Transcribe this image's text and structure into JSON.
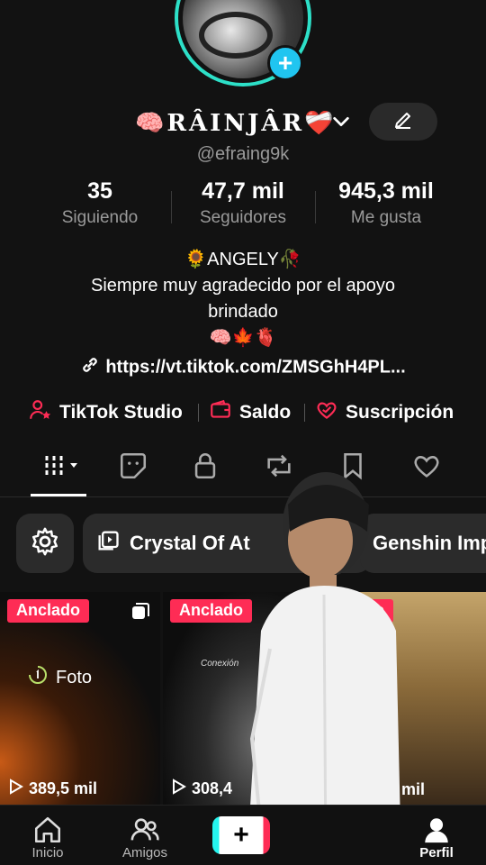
{
  "profile": {
    "display_name": "🧠RÂINJÂR❤️‍🩹",
    "handle": "@efraing9k",
    "add_icon": "plus-icon"
  },
  "stats": [
    {
      "value": "35",
      "label": "Siguiendo"
    },
    {
      "value": "47,7 mil",
      "label": "Seguidores"
    },
    {
      "value": "945,3 mil",
      "label": "Me gusta"
    }
  ],
  "bio": {
    "line1": "🌻ANGELY🥀",
    "line2": "Siempre muy agradecido por el apoyo",
    "line3": "brindado",
    "line4": "🧠🍁🫀"
  },
  "link": {
    "url": "https://vt.tiktok.com/ZMSGhH4PL..."
  },
  "quick_links": [
    {
      "label": "TikTok Studio",
      "icon": "person-star-icon"
    },
    {
      "label": "Saldo",
      "icon": "wallet-icon"
    },
    {
      "label": "Suscripción",
      "icon": "heart-check-icon"
    }
  ],
  "tabs": [
    "grid-icon",
    "sticker-icon",
    "lock-icon",
    "repost-icon",
    "bookmark-icon",
    "heart-icon"
  ],
  "playlists": [
    {
      "label": "Crystal Of At"
    },
    {
      "label": "Genshin Imp"
    }
  ],
  "videos": [
    {
      "badge": "Anclado",
      "views": "389,5 mil",
      "tag": "Foto"
    },
    {
      "badge": "Anclado",
      "views": "308,4",
      "caption": "Conexión"
    },
    {
      "badge": "clado",
      "views": "mil"
    }
  ],
  "nav": [
    {
      "label": "Inicio",
      "icon": "home-icon"
    },
    {
      "label": "Amigos",
      "icon": "friends-icon"
    },
    {
      "label": "+",
      "icon": "create-icon"
    },
    {
      "label": "Perfil",
      "icon": "profile-icon"
    }
  ],
  "colors": {
    "accent": "#fe2c55",
    "ring": "#2de0c8",
    "add": "#20c5f0",
    "background": "#121212"
  }
}
